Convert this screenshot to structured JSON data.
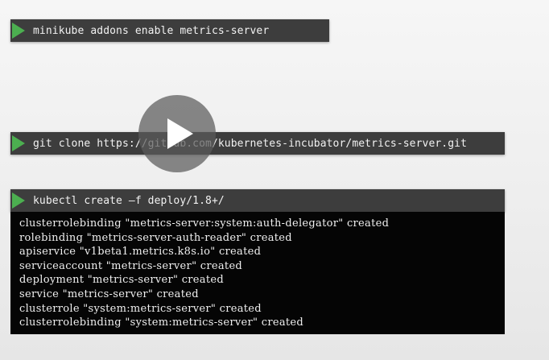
{
  "commands": {
    "enable_addon": "minikube addons enable metrics-server",
    "git_clone": "git clone https://github.com/kubernetes-incubator/metrics-server.git",
    "kubectl_create": "kubectl create –f deploy/1.8+/"
  },
  "output": {
    "lines": [
      "clusterrolebinding \"metrics-server:system:auth-delegator\" created",
      "rolebinding \"metrics-server-auth-reader\" created",
      "apiservice \"v1beta1.metrics.k8s.io\" created",
      "serviceaccount \"metrics-server\" created",
      "deployment \"metrics-server\" created",
      "service \"metrics-server\" created",
      "clusterrole \"system:metrics-server\" created",
      "clusterrolebinding \"system:metrics-server\" created"
    ]
  },
  "colors": {
    "command_bar_bg": "#3d3d3d",
    "prompt_marker": "#4caf50",
    "terminal_bg": "#050505",
    "terminal_text": "#f0f0f0",
    "page_bg": "#f0f0f0"
  },
  "icons": {
    "prompt_marker": "play-triangle-icon",
    "video_overlay": "play-icon"
  }
}
